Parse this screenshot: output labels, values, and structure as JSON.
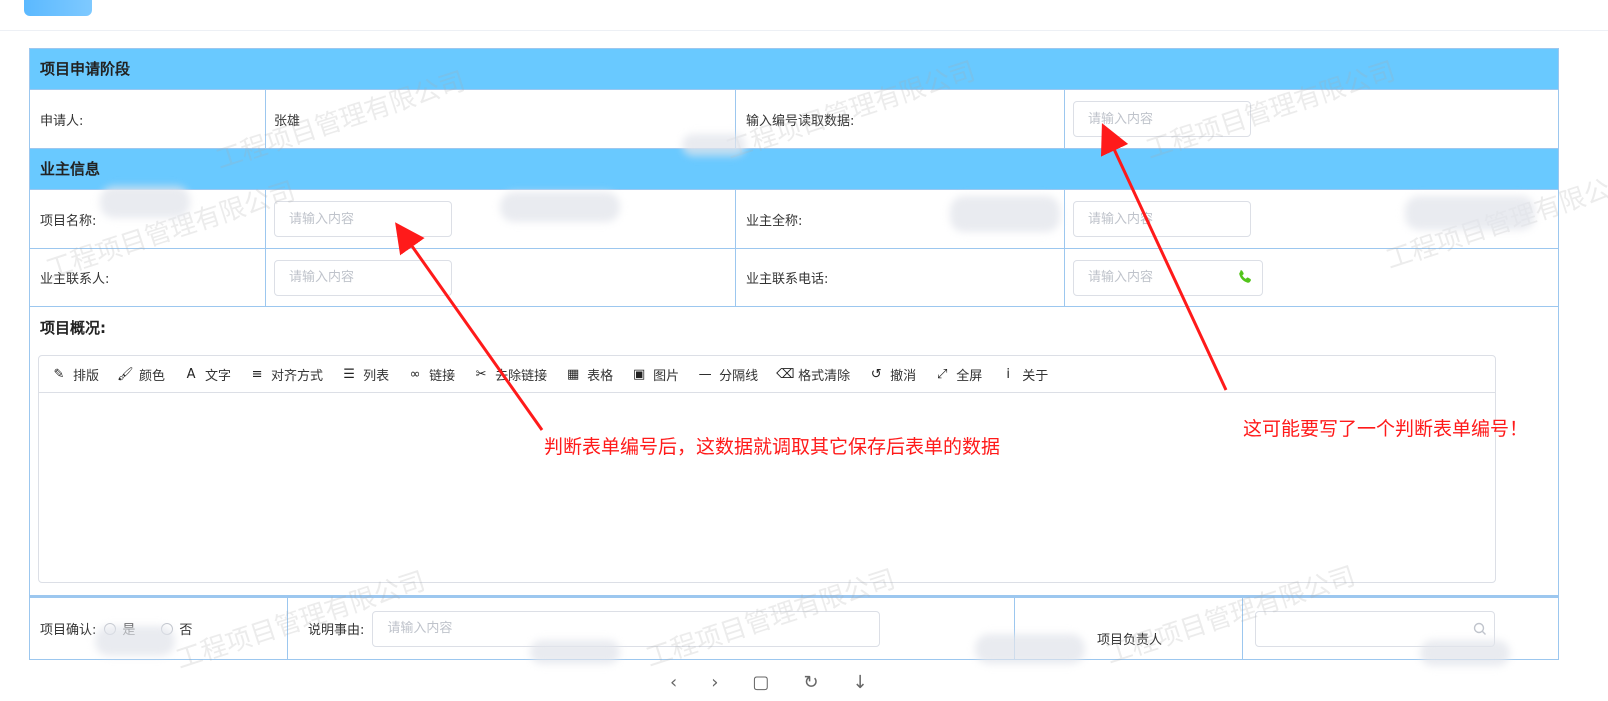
{
  "sections": {
    "application_stage": "项目申请阶段",
    "owner_info": "业主信息"
  },
  "application": {
    "applicant_label": "申请人:",
    "applicant_value": "张雄",
    "number_label": "输入编号读取数据:",
    "number_placeholder": "请输入内容"
  },
  "owner": {
    "project_name_label": "项目名称:",
    "project_name_placeholder": "请输入内容",
    "owner_fullname_label": "业主全称:",
    "owner_fullname_placeholder": "请输入内容",
    "contact_label": "业主联系人:",
    "contact_placeholder": "请输入内容",
    "phone_label": "业主联系电话:",
    "phone_placeholder": "请输入内容"
  },
  "overview": {
    "label": "项目概况:",
    "toolbar": [
      {
        "icon": "pencil-icon",
        "glyph": "✎",
        "label": "排版"
      },
      {
        "icon": "brush-icon",
        "glyph": "🖌",
        "label": "颜色"
      },
      {
        "icon": "font-icon",
        "glyph": "A",
        "label": "文字"
      },
      {
        "icon": "align-icon",
        "glyph": "≡",
        "label": "对齐方式"
      },
      {
        "icon": "list-icon",
        "glyph": "☰",
        "label": "列表"
      },
      {
        "icon": "link-icon",
        "glyph": "∞",
        "label": "链接"
      },
      {
        "icon": "unlink-icon",
        "glyph": "✂",
        "label": "去除链接"
      },
      {
        "icon": "table-icon",
        "glyph": "▦",
        "label": "表格"
      },
      {
        "icon": "image-icon",
        "glyph": "▣",
        "label": "图片"
      },
      {
        "icon": "divider-icon",
        "glyph": "—",
        "label": "分隔线"
      },
      {
        "icon": "eraser-icon",
        "glyph": "⌫",
        "label": "格式清除"
      },
      {
        "icon": "undo-icon",
        "glyph": "↺",
        "label": "撤消"
      },
      {
        "icon": "fullscreen-icon",
        "glyph": "⤢",
        "label": "全屏"
      },
      {
        "icon": "info-icon",
        "glyph": "i",
        "label": "关于"
      }
    ]
  },
  "confirm": {
    "label": "项目确认:",
    "yes": "是",
    "no": "否",
    "reason_label": "说明事由:",
    "reason_placeholder": "请输入内容",
    "manager_label": "项目负责人"
  },
  "annotations": {
    "left": "判断表单编号后，这数据就调取其它保存后表单的数据",
    "right": "这可能要写了一个判断表单编号！"
  },
  "watermark_text": "工程项目管理有限公司",
  "colors": {
    "header_bg": "#69c9ff",
    "border": "#9cc7ef",
    "annotation": "#ff1a1a",
    "phone_icon": "#52c41a"
  }
}
